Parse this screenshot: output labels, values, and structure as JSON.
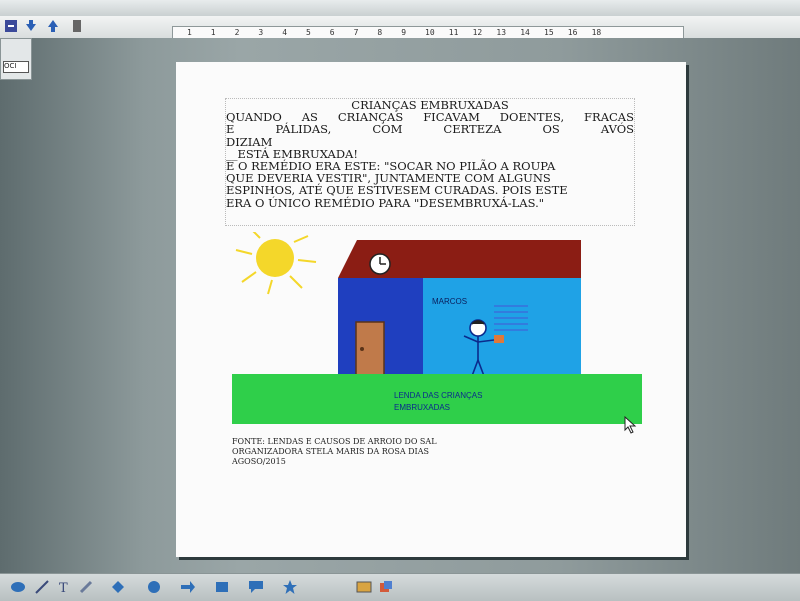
{
  "document": {
    "title": "CRIANÇAS EMBRUXADAS",
    "lines": [
      "QUANDO AS CRIANÇAS FICAVAM DOENTES, FRACAS",
      "E PÁLIDAS, COM CERTEZA OS AVÓS",
      "DIZIAM",
      "__ESTÁ EMBRUXADA!",
      "E O REMÉDIO ERA ESTE: \"SOCAR NO PILÃO A ROUPA",
      "QUE DEVERIA VESTIR\", JUNTAMENTE COM ALGUNS",
      "ESPINHOS, ATÉ QUE ESTIVESEM CURADAS. POIS ESTE",
      "ERA O ÚNICO REMÉDIO PARA \"DESEMBRUXÁ-LAS.\""
    ],
    "drawing": {
      "name_label": "MARCOS",
      "ground_label_line1": "LENDA DAS CRIANÇAS",
      "ground_label_line2": "EMBRUXADAS"
    },
    "source_lines": [
      "FONTE: LENDAS E CAUSOS DE ARROIO DO SAL",
      "ORGANIZADORA STELA MARIS DA ROSA DIAS",
      "AGOSO/2015"
    ]
  },
  "ruler": {
    "ticks": [
      "1",
      "1",
      "2",
      "3",
      "4",
      "5",
      "6",
      "7",
      "8",
      "9",
      "10",
      "11",
      "12",
      "13",
      "14",
      "15",
      "16",
      "18"
    ]
  },
  "leftpane": {
    "label": "OCI"
  },
  "colors": {
    "roof": "#8b1d14",
    "wall_dark": "#1f3fbf",
    "wall_light": "#1fa2e6",
    "door": "#c07a4a",
    "grass": "#2fcf4a",
    "sun": "#f4d72a"
  }
}
